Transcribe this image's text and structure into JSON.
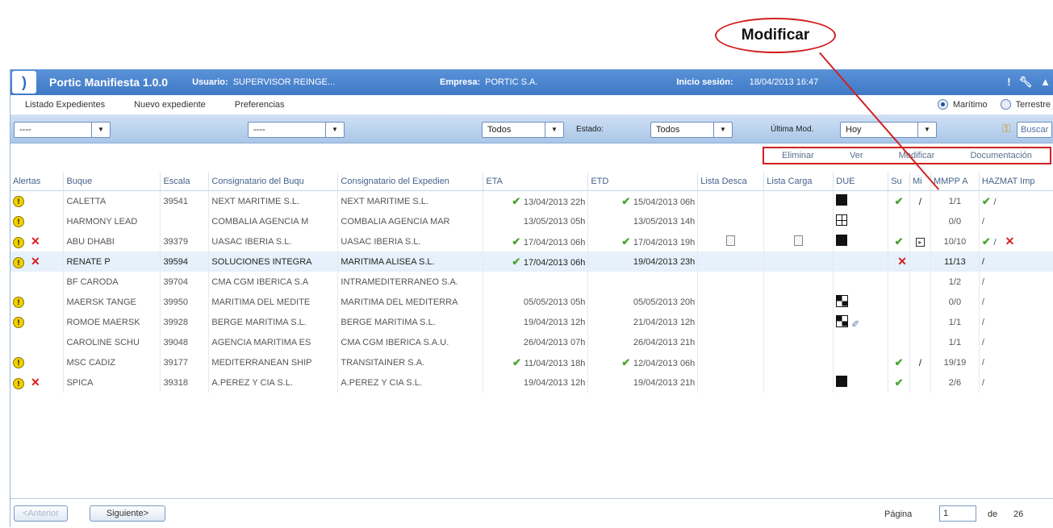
{
  "callout": {
    "label": "Modificar"
  },
  "header": {
    "app_title": "Portic Manifiesta 1.0.0",
    "user_label": "Usuario:",
    "user_value": "SUPERVISOR REINGE...",
    "company_label": "Empresa:",
    "company_value": "PORTIC S.A.",
    "session_label": "Inicio sesión:",
    "session_value": "18/04/2013 16:47",
    "icons": [
      "alert-icon",
      "wrench-icon",
      "cap-icon"
    ]
  },
  "menu": {
    "items": [
      "Listado Expedientes",
      "Nuevo expediente",
      "Preferencias"
    ],
    "mode_options": [
      "Marítimo",
      "Terrestre"
    ],
    "mode_selected": "Marítimo"
  },
  "filters": {
    "select1": "----",
    "select2": "----",
    "select3": "Todos",
    "estado_label": "Estado:",
    "estado_value": "Todos",
    "ultima_label": "Última Mod.",
    "ultima_value": "Hoy",
    "search_label": "Buscar"
  },
  "actions": [
    "Eliminar",
    "Ver",
    "Modificar",
    "Documentación"
  ],
  "table": {
    "headers": [
      "Alertas",
      "Buque",
      "Escala",
      "Consignatario del Buqu",
      "Consignatario del Expedien",
      "ETA",
      "ETD",
      "Lista Desca",
      "Lista Carga",
      "DUE",
      "Su",
      "Mi",
      "MMPP A",
      "HAZMAT Imp"
    ],
    "rows": [
      {
        "warn": true,
        "x": false,
        "buque": "CALETTA",
        "escala": "39541",
        "cons_buque": "NEXT MARITIME S.L.",
        "cons_exp": "NEXT MARITIME S.L.",
        "eta_ok": true,
        "eta": "13/04/2013 22h",
        "etd_ok": true,
        "etd": "15/04/2013 06h",
        "desc": false,
        "carga": false,
        "due": "black",
        "su": true,
        "mi": "pen",
        "mmpp": "1/1",
        "hz_ok": true,
        "hz_x": false
      },
      {
        "warn": true,
        "x": false,
        "buque": "HARMONY LEAD",
        "escala": "",
        "cons_buque": "COMBALIA AGENCIA M",
        "cons_exp": "COMBALIA AGENCIA MAR",
        "eta_ok": false,
        "eta": "13/05/2013 05h",
        "etd_ok": false,
        "etd": "13/05/2013 14h",
        "desc": false,
        "carga": false,
        "due": "grid",
        "su": false,
        "mi": "",
        "mmpp": "0/0",
        "hz_ok": false,
        "hz_x": false
      },
      {
        "warn": true,
        "x": true,
        "buque": "ABU DHABI",
        "escala": "39379",
        "cons_buque": "UASAC IBERIA S.L.",
        "cons_exp": "UASAC IBERIA S.L.",
        "eta_ok": true,
        "eta": "17/04/2013 06h",
        "etd_ok": true,
        "etd": "17/04/2013 19h",
        "desc": true,
        "carga": true,
        "due": "black",
        "su": true,
        "mi": "box",
        "mmpp": "10/10",
        "hz_ok": true,
        "hz_x": true
      },
      {
        "warn": true,
        "x": true,
        "buque": "RENATE P",
        "escala": "39594",
        "cons_buque": "SOLUCIONES INTEGRA",
        "cons_exp": "MARITIMA ALISEA S.L.",
        "eta_ok": true,
        "eta": "17/04/2013 06h",
        "etd_ok": false,
        "etd": "19/04/2013 23h",
        "desc": false,
        "carga": false,
        "due": "",
        "su": "x",
        "mi": "",
        "mmpp": "11/13",
        "hz_ok": false,
        "hz_x": false
      },
      {
        "warn": false,
        "x": false,
        "buque": "BF CARODA",
        "escala": "39704",
        "cons_buque": "CMA CGM IBERICA S.A",
        "cons_exp": "INTRAMEDITERRANEO S.A.",
        "eta_ok": false,
        "eta": "",
        "etd_ok": false,
        "etd": "",
        "desc": false,
        "carga": false,
        "due": "",
        "su": false,
        "mi": "",
        "mmpp": "1/2",
        "hz_ok": false,
        "hz_x": false
      },
      {
        "warn": true,
        "x": false,
        "buque": "MAERSK TANGE",
        "escala": "39950",
        "cons_buque": "MARITIMA DEL MEDITE",
        "cons_exp": "MARITIMA DEL MEDITERRA",
        "eta_ok": false,
        "eta": "05/05/2013 05h",
        "etd_ok": false,
        "etd": "05/05/2013 20h",
        "desc": false,
        "carga": false,
        "due": "check",
        "su": false,
        "mi": "",
        "mmpp": "0/0",
        "hz_ok": false,
        "hz_x": false
      },
      {
        "warn": true,
        "x": false,
        "buque": "ROMOE MAERSK",
        "escala": "39928",
        "cons_buque": "BERGE MARITIMA S.L.",
        "cons_exp": "BERGE MARITIMA S.L.",
        "eta_ok": false,
        "eta": "19/04/2013 12h",
        "etd_ok": false,
        "etd": "21/04/2013 12h",
        "desc": false,
        "carga": false,
        "due": "check-clip",
        "su": false,
        "mi": "",
        "mmpp": "1/1",
        "hz_ok": false,
        "hz_x": false
      },
      {
        "warn": false,
        "x": false,
        "buque": "CAROLINE SCHU",
        "escala": "39048",
        "cons_buque": "AGENCIA MARITIMA ES",
        "cons_exp": "CMA CGM IBERICA S.A.U.",
        "eta_ok": false,
        "eta": "26/04/2013 07h",
        "etd_ok": false,
        "etd": "26/04/2013 21h",
        "desc": false,
        "carga": false,
        "due": "",
        "su": false,
        "mi": "",
        "mmpp": "1/1",
        "hz_ok": false,
        "hz_x": false
      },
      {
        "warn": true,
        "x": false,
        "buque": "MSC CADIZ",
        "escala": "39177",
        "cons_buque": "MEDITERRANEAN SHIP",
        "cons_exp": "TRANSITAINER S.A.",
        "eta_ok": true,
        "eta": "11/04/2013 18h",
        "etd_ok": true,
        "etd": "12/04/2013 06h",
        "desc": false,
        "carga": false,
        "due": "",
        "su": true,
        "mi": "pen",
        "mmpp": "19/19",
        "hz_ok": false,
        "hz_x": false
      },
      {
        "warn": true,
        "x": true,
        "buque": "SPICA",
        "escala": "39318",
        "cons_buque": "A.PEREZ Y CIA S.L.",
        "cons_exp": "A.PEREZ Y CIA S.L.",
        "eta_ok": false,
        "eta": "19/04/2013 12h",
        "etd_ok": false,
        "etd": "19/04/2013 21h",
        "desc": false,
        "carga": false,
        "due": "black",
        "su": true,
        "mi": "",
        "mmpp": "2/6",
        "hz_ok": false,
        "hz_x": false
      }
    ],
    "selected_row": 3
  },
  "pager": {
    "prev": "<Anterior",
    "next": "Siguiente>",
    "page_label": "Página",
    "page_value": "1",
    "of_label": "de",
    "total": "26"
  }
}
